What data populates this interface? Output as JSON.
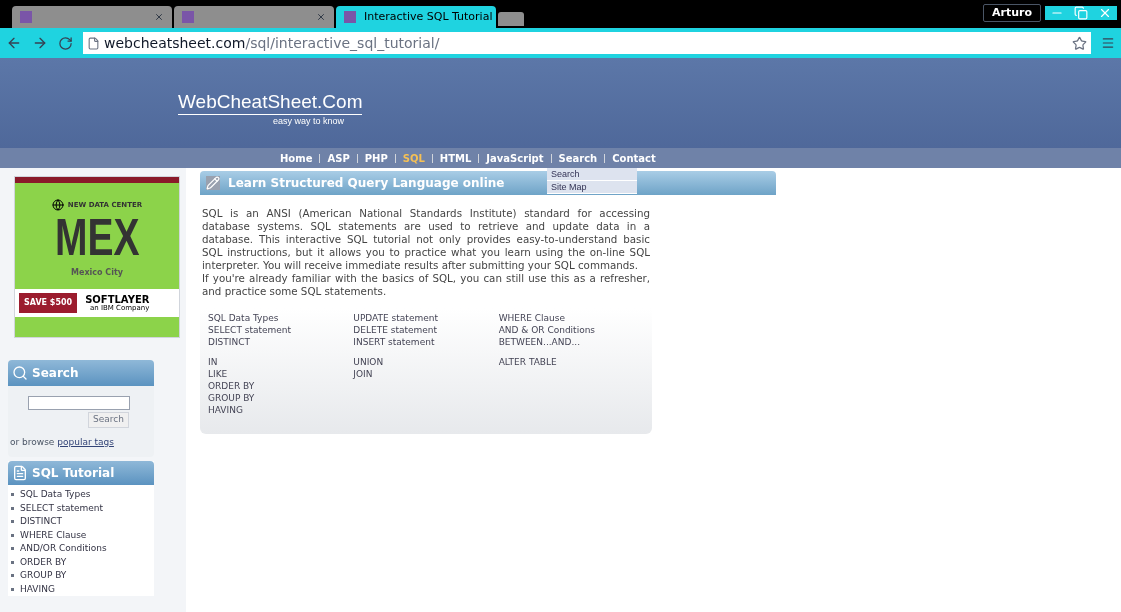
{
  "browser": {
    "tabs": [
      {
        "selected": false
      },
      {
        "selected": false
      },
      {
        "title": "Interactive SQL Tutorial",
        "selected": true
      }
    ],
    "user": "Arturo",
    "url_host": "webcheatsheet.com",
    "url_path": "/sql/interactive_sql_tutorial/"
  },
  "header": {
    "logo": "WebCheatSheet.Com",
    "tagline": "easy way to know"
  },
  "nav": [
    {
      "label": "Home",
      "selected": false
    },
    {
      "label": "ASP",
      "selected": false
    },
    {
      "label": "PHP",
      "selected": false
    },
    {
      "label": "SQL",
      "selected": true
    },
    {
      "label": "HTML",
      "selected": false
    },
    {
      "label": "JavaScript",
      "selected": false
    },
    {
      "label": "Search",
      "selected": false
    },
    {
      "label": "Contact",
      "selected": false
    }
  ],
  "nav_menu": [
    "Search",
    "Site Map"
  ],
  "ad": {
    "badge": "NEW DATA CENTER",
    "code": "MEX",
    "city": "Mexico City",
    "offer": "SAVE $500",
    "brand": "SOFTLAYER",
    "brand_sub": "an IBM Company"
  },
  "search_box": {
    "title": "Search",
    "button": "Search",
    "browse_prefix": "or browse",
    "browse_link": "popular tags"
  },
  "sql_tutorial": {
    "title": "SQL Tutorial",
    "items": [
      "SQL Data Types",
      "SELECT statement",
      "DISTINCT",
      "WHERE Clause",
      "AND/OR Conditions",
      "ORDER BY",
      "GROUP BY",
      "HAVING"
    ]
  },
  "main": {
    "title": "Learn Structured Query Language online",
    "paragraphs": [
      "SQL is an ANSI (American National Standards Institute) standard for accessing database systems. SQL statements are used to retrieve and update data in a database. This interactive SQL tutorial not only provides easy-to-understand basic SQL instructions, but it allows you to practice what you learn using the on-line SQL interpreter. You will receive immediate results after submitting your SQL commands.",
      "If you're already familiar with the basics of SQL, you can still use this as a refresher, and practice some SQL statements."
    ],
    "link_groups": [
      [
        [
          "SQL Data Types",
          "SELECT statement",
          "DISTINCT"
        ],
        [
          "UPDATE statement",
          "DELETE statement",
          "INSERT statement"
        ],
        [
          "WHERE Clause",
          "AND & OR Conditions",
          "BETWEEN...AND..."
        ]
      ],
      [
        [
          "IN",
          "LIKE",
          "ORDER BY",
          "GROUP BY",
          "HAVING"
        ],
        [
          "UNION",
          "JOIN"
        ],
        [
          "ALTER TABLE"
        ]
      ]
    ]
  }
}
